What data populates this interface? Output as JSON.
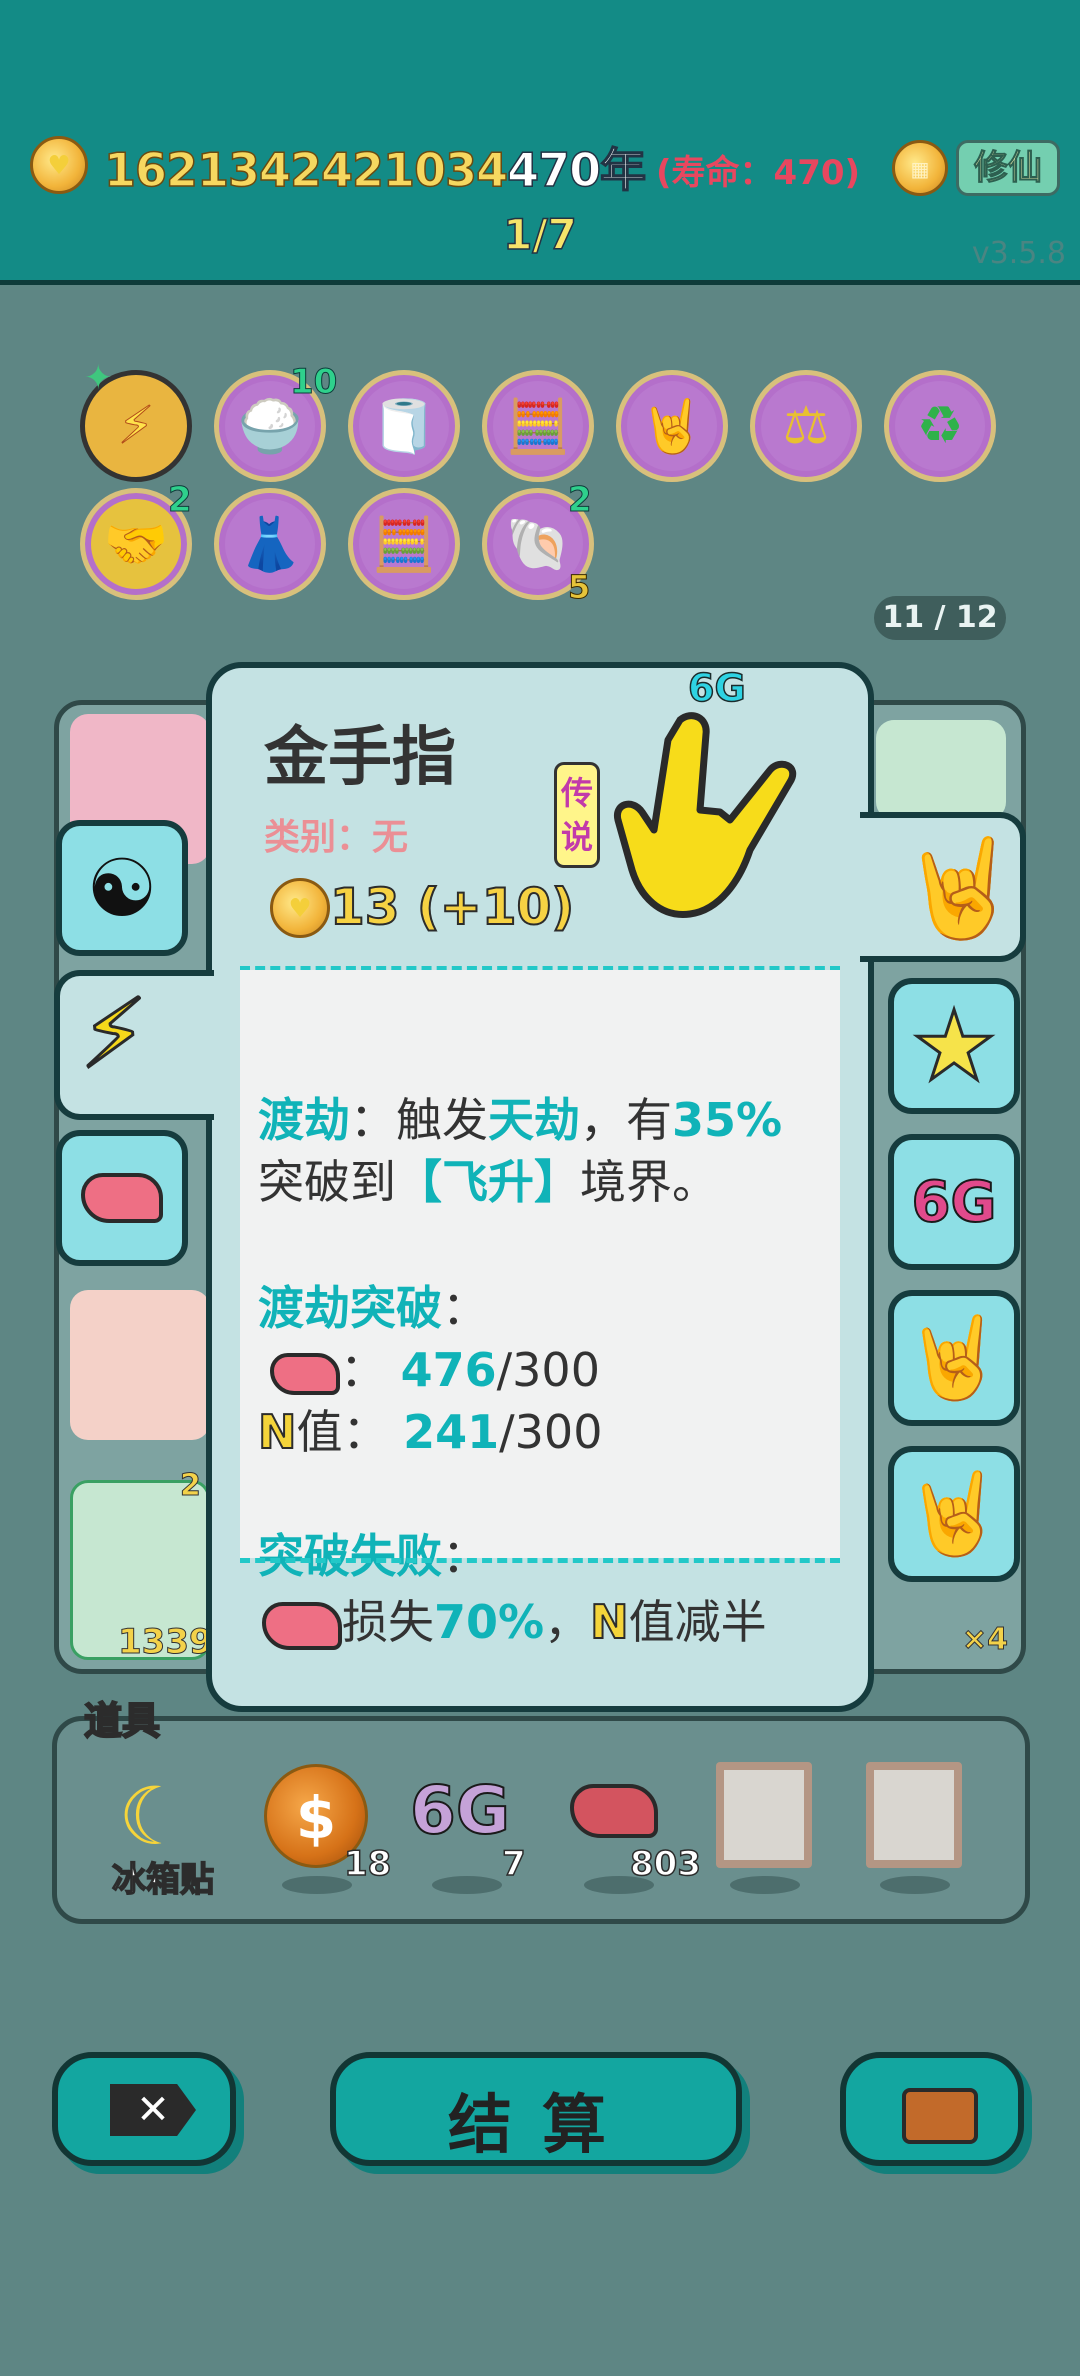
{
  "header": {
    "coins": "1621342421034",
    "years": "470年",
    "lifespan": "(寿命：470)",
    "cultivate_button": "修仙",
    "stage": "1/7",
    "version": "v3.5.8"
  },
  "skills": {
    "row1": [
      {
        "icon": "lightning-icon",
        "glyph": "⚡",
        "count": ""
      },
      {
        "icon": "rice-bowl-icon",
        "glyph": "🍚",
        "count": "10"
      },
      {
        "icon": "tissue-box-icon",
        "glyph": "🧻",
        "count": ""
      },
      {
        "icon": "math-face-icon",
        "glyph": "🧮",
        "count": ""
      },
      {
        "icon": "rock-hand-icon",
        "glyph": "🤘",
        "count": ""
      },
      {
        "icon": "balance-icon",
        "glyph": "⚖",
        "count": ""
      },
      {
        "icon": "recycle-icon",
        "glyph": "♻",
        "count": ""
      }
    ],
    "row2": [
      {
        "icon": "handshake-icon",
        "glyph": "🤝",
        "count": "2"
      },
      {
        "icon": "skirt-icon",
        "glyph": "👗",
        "count": ""
      },
      {
        "icon": "math-face-icon",
        "glyph": "🧮",
        "count": ""
      },
      {
        "icon": "shell-icon",
        "glyph": "🐚",
        "count": "2",
        "sub": "5"
      }
    ],
    "page": "11 / 12"
  },
  "popup": {
    "tag": "6G",
    "title": "金手指",
    "category": "类别：无",
    "rarity": "传说",
    "price": "13 (+10)",
    "desc": {
      "kw1": "渡劫",
      "t1": "：触发",
      "kw2": "天劫",
      "t2": "，有",
      "pct": "35%",
      "line2a": "突破到",
      "kw3": "【飞升】",
      "line2b": "境界。",
      "success_title": "渡劫突破",
      "colon": "：",
      "liver_sep": "：",
      "liver_val": "476",
      "liver_max": "/300",
      "n_letter": "N",
      "n_label": "值：",
      "n_val": "241",
      "n_max": "/300",
      "fail_title": "突破失败",
      "fail_t1": "损失",
      "fail_pct": "70%",
      "fail_t2": "，",
      "fail_n": "N",
      "fail_t3": "值减半"
    }
  },
  "side_buttons": {
    "left": [
      "yin-yang-icon",
      "lightning-icon",
      "liver-icon"
    ],
    "right": [
      "rock-hand-yellow-icon",
      "star-icon",
      "6g-icon",
      "rock-hand-white-icon",
      "rock-hand-brown-icon"
    ],
    "right_6g_label": "6G"
  },
  "props": {
    "title": "道具",
    "items": [
      {
        "name": "冰箱贴",
        "count": ""
      },
      {
        "name": "coin",
        "count": "18"
      },
      {
        "name": "6G",
        "count": "7"
      },
      {
        "name": "liver",
        "count": "803"
      }
    ]
  },
  "bottom": {
    "settle": "结算"
  },
  "background": {
    "bg_count_1": "1339",
    "bg_count_2": "×4",
    "bg_coin": "2"
  }
}
